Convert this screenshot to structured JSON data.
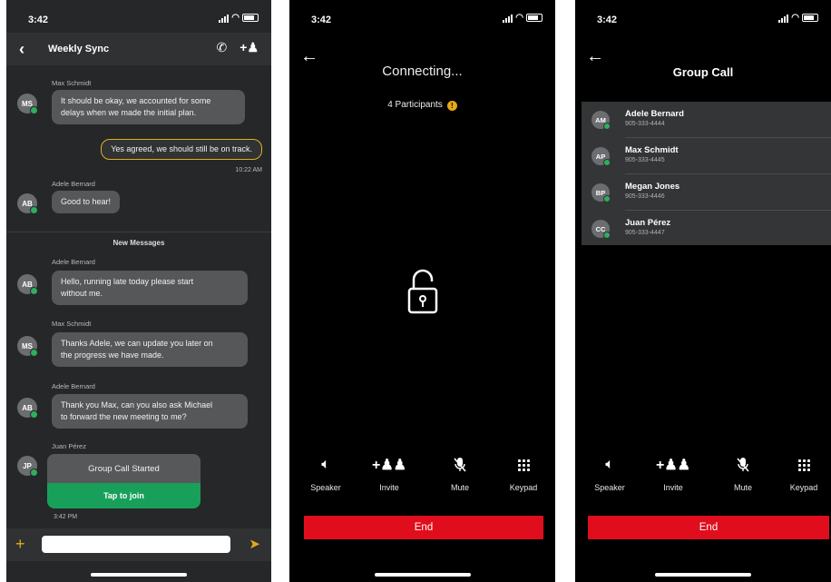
{
  "status": {
    "time": "3:42"
  },
  "chat": {
    "title": "Weekly Sync",
    "messages": [
      {
        "sender": "Max Schmidt",
        "initials": "MS",
        "lines": [
          "It should be okay, we accounted for some",
          "delays when we made the initial plan."
        ]
      },
      {
        "outgoing": "Yes agreed, we should still be on track.",
        "time": "10:22 AM"
      },
      {
        "sender": "Adele Bernard",
        "initials": "AB",
        "lines": [
          "Good to hear!"
        ]
      }
    ],
    "new_messages_label": "New Messages",
    "new_messages": [
      {
        "sender": "Adele Bernard",
        "initials": "AB",
        "lines": [
          "Hello, running late today please start",
          "without me."
        ]
      },
      {
        "sender": "Max Schmidt",
        "initials": "MS",
        "lines": [
          "Thanks Adele, we can update you later on",
          "the progress we have made."
        ]
      },
      {
        "sender": "Adele Bernard",
        "initials": "AB",
        "lines": [
          "Thank you Max, can you also ask Michael",
          "to forward the new meeting to me?"
        ]
      }
    ],
    "call": {
      "sender": "Juan Pérez",
      "initials": "JP",
      "title": "Group Call Started",
      "join_label": "Tap to join",
      "time": "3:42 PM"
    }
  },
  "connecting": {
    "title": "Connecting...",
    "participants": "4 Participants",
    "info": "!"
  },
  "controls": {
    "speaker": "Speaker",
    "invite": "Invite",
    "mute": "Mute",
    "keypad": "Keypad",
    "end": "End"
  },
  "group_call": {
    "title": "Group Call",
    "participants": [
      {
        "initials": "AM",
        "name": "Adele Bernard",
        "phone": "905-333-4444"
      },
      {
        "initials": "AP",
        "name": "Max Schmidt",
        "phone": "905-333-4445"
      },
      {
        "initials": "BP",
        "name": "Megan Jones",
        "phone": "905-333-4446"
      },
      {
        "initials": "CC",
        "name": "Juan Pérez",
        "phone": "905-333-4447"
      }
    ]
  },
  "colors": {
    "accent": "#e6a817",
    "online": "#2fae5c",
    "join": "#18a05a",
    "end": "#e00e1c"
  }
}
